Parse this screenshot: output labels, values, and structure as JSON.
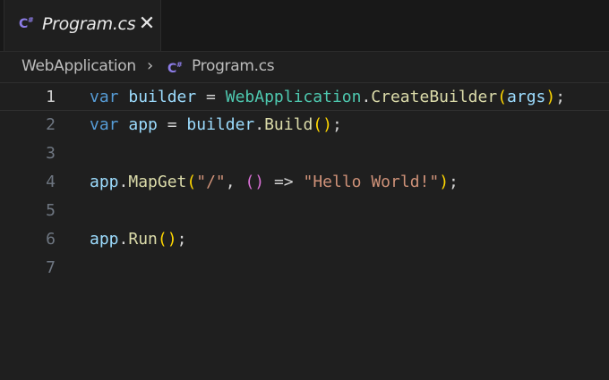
{
  "tab": {
    "label": "Program.cs",
    "close": "✕"
  },
  "breadcrumb": {
    "project": "WebApplication",
    "separator": "›",
    "file": "Program.cs"
  },
  "colors": {
    "background": "#1f1f1f",
    "keyword": "#569cd6",
    "variable": "#9cdcfe",
    "type": "#4ec9b0",
    "method": "#dcdcaa",
    "string": "#ce9178",
    "bracket_level1": "#ffd700",
    "bracket_level2": "#da70d6",
    "csharp_icon": "#8c7ce6"
  },
  "editor": {
    "line_numbers": [
      "1",
      "2",
      "3",
      "4",
      "5",
      "6",
      "7"
    ],
    "line1": {
      "kw": "var",
      "v1": " builder",
      "op1": " = ",
      "cls": "WebApplication",
      "dot": ".",
      "fn": "CreateBuilder",
      "p_open": "(",
      "arg": "args",
      "p_close": ")",
      "end": ";"
    },
    "line2": {
      "kw": "var",
      "v1": " app",
      "op1": " = ",
      "v2": "builder",
      "dot": ".",
      "fn": "Build",
      "p_open": "(",
      "p_close": ")",
      "end": ";"
    },
    "line4": {
      "v1": "app",
      "dot": ".",
      "fn": "MapGet",
      "p_open": "(",
      "s1": "\"/\"",
      "comma": ", ",
      "l_open": "(",
      "l_close": ")",
      "arrow": " => ",
      "s2": "\"Hello World!\"",
      "p_close": ")",
      "end": ";"
    },
    "line6": {
      "v1": "app",
      "dot": ".",
      "fn": "Run",
      "p_open": "(",
      "p_close": ")",
      "end": ";"
    }
  }
}
